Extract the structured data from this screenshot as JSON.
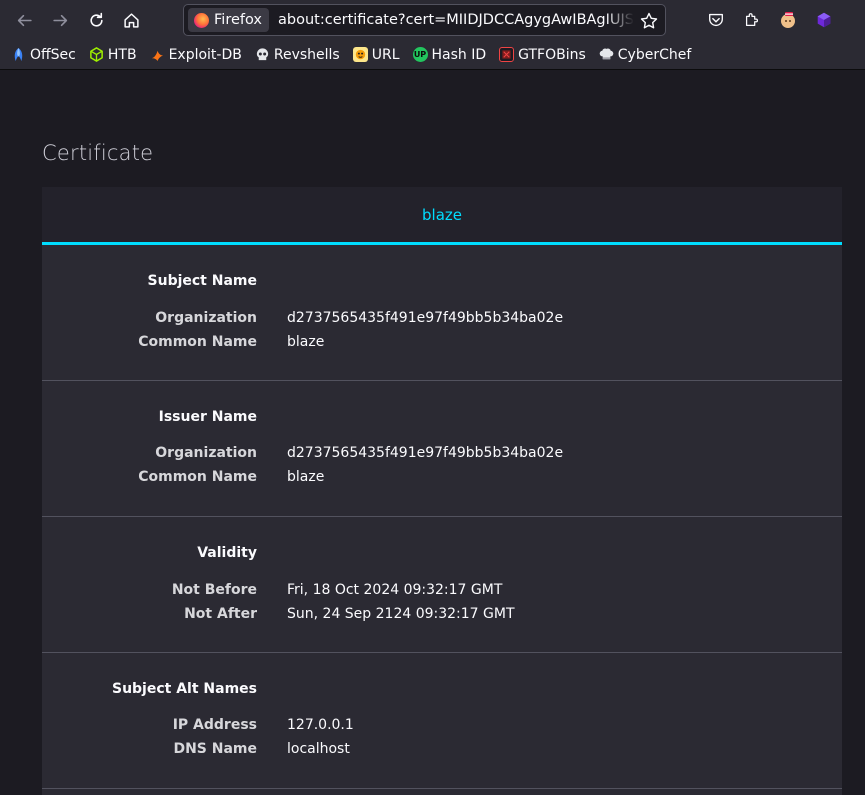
{
  "browser": {
    "identity_label": "Firefox",
    "url": "about:certificate?cert=MIIDJDCCAgygAwIBAgIUJSBPZfkR"
  },
  "bookmarks": [
    {
      "label": "OffSec",
      "icon": "offsec-icon",
      "color": "#3b82f6"
    },
    {
      "label": "HTB",
      "icon": "htb-cube-icon",
      "color": "#9fef00"
    },
    {
      "label": "Exploit-DB",
      "icon": "exploitdb-icon",
      "color": "#f97316"
    },
    {
      "label": "Revshells",
      "icon": "skull-icon",
      "color": "#e5e7eb"
    },
    {
      "label": "URL",
      "icon": "url-decoder-icon",
      "color": "#f59e0b"
    },
    {
      "label": "Hash ID",
      "icon": "hashid-icon",
      "color": "#22c55e"
    },
    {
      "label": "GTFOBins",
      "icon": "gtfobins-icon",
      "color": "#ef4444"
    },
    {
      "label": "CyberChef",
      "icon": "chef-hat-icon",
      "color": "#e5e7eb"
    }
  ],
  "page": {
    "title": "Certificate",
    "tab": "blaze"
  },
  "sections": [
    {
      "title": "Subject Name",
      "rows": [
        {
          "key": "Organization",
          "value": "d2737565435f491e97f49bb5b34ba02e"
        },
        {
          "key": "Common Name",
          "value": "blaze"
        }
      ]
    },
    {
      "title": "Issuer Name",
      "rows": [
        {
          "key": "Organization",
          "value": "d2737565435f491e97f49bb5b34ba02e"
        },
        {
          "key": "Common Name",
          "value": "blaze"
        }
      ]
    },
    {
      "title": "Validity",
      "rows": [
        {
          "key": "Not Before",
          "value": "Fri, 18 Oct 2024 09:32:17 GMT"
        },
        {
          "key": "Not After",
          "value": "Sun, 24 Sep 2124 09:32:17 GMT"
        }
      ]
    },
    {
      "title": "Subject Alt Names",
      "rows": [
        {
          "key": "IP Address",
          "value": "127.0.0.1"
        },
        {
          "key": "DNS Name",
          "value": "localhost"
        }
      ]
    }
  ]
}
